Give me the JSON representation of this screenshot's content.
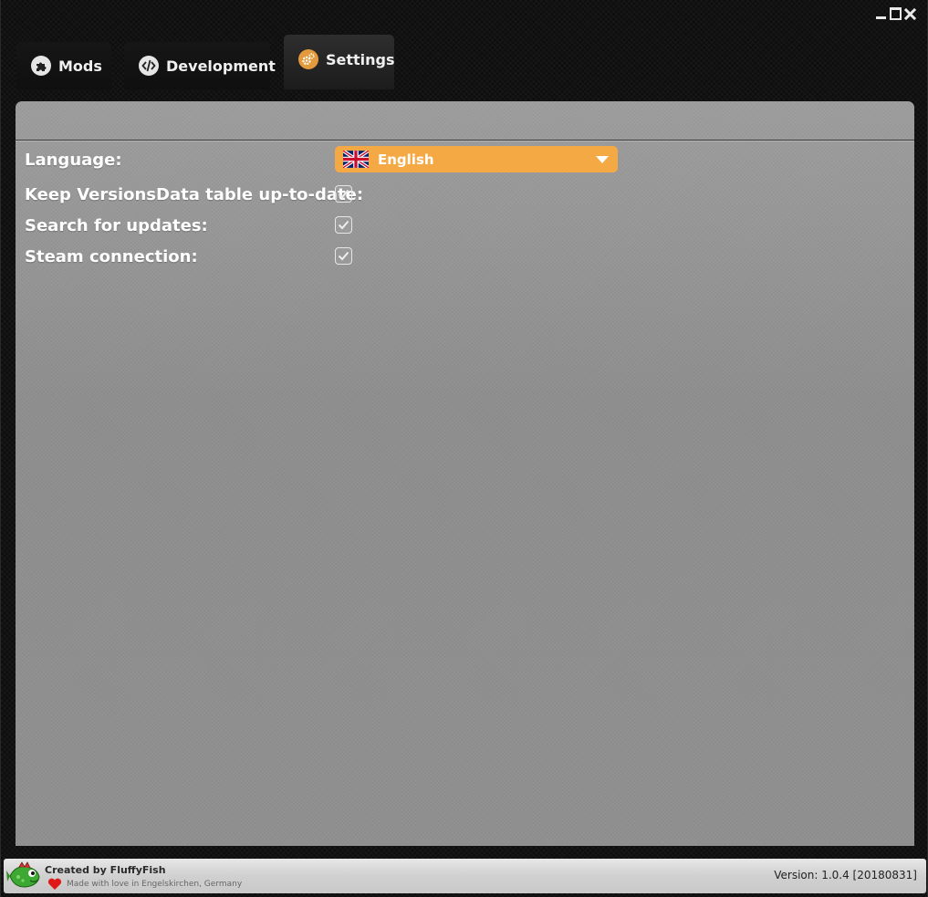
{
  "window": {
    "controls": [
      "minimize-icon",
      "maximize-icon",
      "close-icon"
    ]
  },
  "tabs": [
    {
      "label": "Mods",
      "icon": "puzzle-icon",
      "active": false
    },
    {
      "label": "Development",
      "icon": "code-icon",
      "active": false
    },
    {
      "label": "Settings",
      "icon": "gears-icon",
      "active": true
    }
  ],
  "settings": {
    "language_label": "Language:",
    "language_value": "English",
    "language_flag": "uk-flag-icon",
    "keep_versions_label": "Keep VersionsData table up-to-date:",
    "keep_versions_checked": true,
    "search_updates_label": "Search for updates:",
    "search_updates_checked": true,
    "steam_label": "Steam connection:",
    "steam_checked": true
  },
  "footer": {
    "created_by": "Created by FluffyFish",
    "made_with": "Made with love in Engelskirchen, Germany",
    "version": "Version:  1.0.4 [20180831]"
  },
  "colors": {
    "accent": "#f4a944",
    "panel": "#929292",
    "background": "#0d0d0d"
  }
}
